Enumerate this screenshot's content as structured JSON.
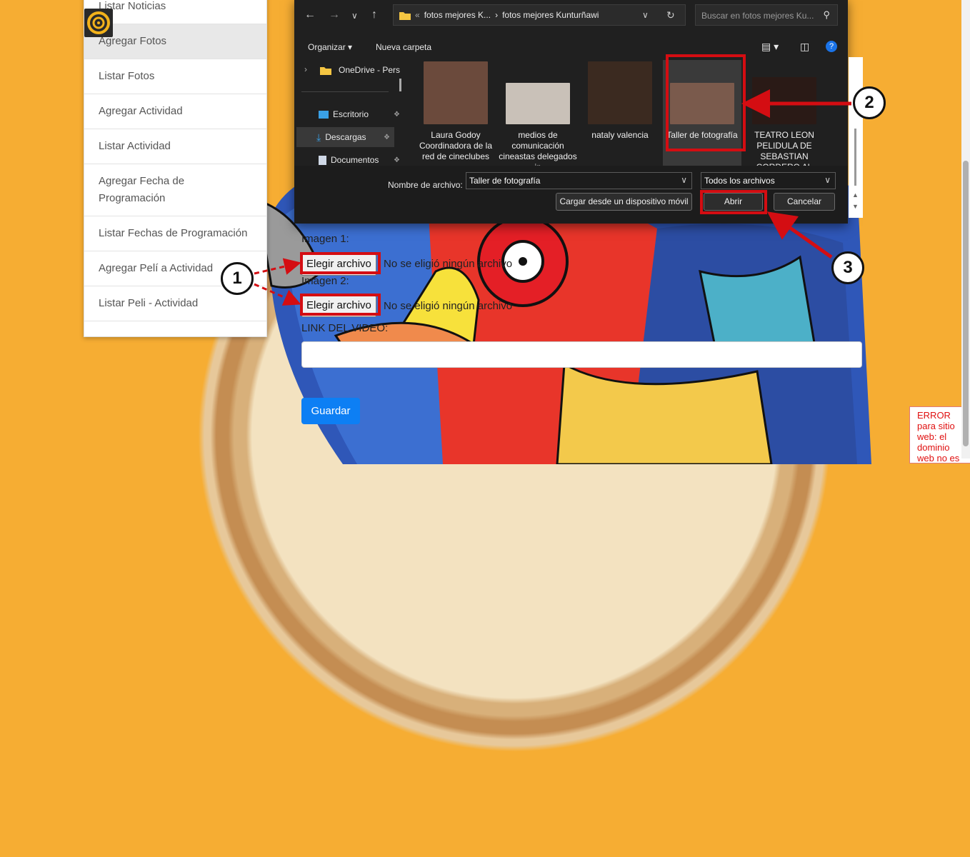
{
  "menu": {
    "items": [
      {
        "label": "Listar Noticias"
      },
      {
        "label": "Agregar Fotos"
      },
      {
        "label": "Listar Fotos"
      },
      {
        "label": "Agregar Actividad"
      },
      {
        "label": "Listar Actividad"
      },
      {
        "label": "Agregar Fecha de Programación"
      },
      {
        "label": "Listar Fechas de Programación"
      },
      {
        "label": "Agregar Pelí a Actividad"
      },
      {
        "label": "Listar Peli - Actividad"
      }
    ]
  },
  "form": {
    "image1_label": "Imagen 1:",
    "image2_label": "Imagen 2:",
    "choose_file": "Elegir archivo",
    "no_file": "No se eligió ningún archivo",
    "video_label": "LINK DEL VIDEO:",
    "save": "Guardar"
  },
  "error": {
    "text": "ERROR para sitio web: el dominio web no es"
  },
  "dialog": {
    "breadcrumb": [
      "fotos mejores K...",
      "fotos mejores Kunturñawi"
    ],
    "search_placeholder": "Buscar en fotos mejores Ku...",
    "organize": "Organizar",
    "new_folder": "Nueva carpeta",
    "nav_items": [
      {
        "label": "OneDrive - Pers",
        "icon": "folder-icon"
      },
      {
        "label": "Escritorio",
        "icon": "desktop-icon"
      },
      {
        "label": "Descargas",
        "icon": "download-icon"
      },
      {
        "label": "Documentos",
        "icon": "document-icon"
      }
    ],
    "files": [
      {
        "caption": "Laura Godoy Coordinadora de la red de cineclubes",
        "color": "#6b4a3c"
      },
      {
        "caption": "medios de comunicación cineastas delegados in",
        "color": "#c9c1b8"
      },
      {
        "caption": "nataly valencia",
        "color": "#3b2a20"
      },
      {
        "caption": "Taller de fotografía",
        "color": "#7a5a4c"
      },
      {
        "caption": "TEATRO LEON PELIDULA DE SEBASTIAN CORDERO AL",
        "color": "#2a1a16"
      }
    ],
    "filename_label": "Nombre de archivo:",
    "filename_value": "Taller de fotografía",
    "filetype": "Todos los archivos",
    "device_btn": "Cargar desde un dispositivo móvil",
    "open_btn": "Abrir",
    "cancel_btn": "Cancelar"
  },
  "callouts": [
    "1",
    "2",
    "3"
  ]
}
